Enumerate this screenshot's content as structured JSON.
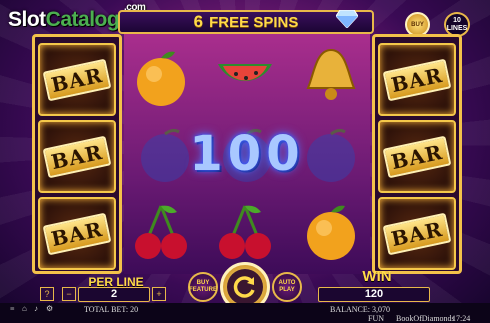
{
  "logo": {
    "text_slot": "Slot",
    "text_catalog": "Catalog",
    "text_com": ".com"
  },
  "header": {
    "spins_count": "6",
    "spins_label": "FREE SPINS"
  },
  "badges": {
    "buy_text": "BUY",
    "lines_count": "10",
    "lines_label": "LINES"
  },
  "reels": {
    "left_column": [
      "BAR",
      "BAR",
      "BAR"
    ],
    "right_column": [
      "BAR",
      "BAR",
      "BAR"
    ],
    "middle": [
      [
        "orange",
        "watermelon",
        "bell"
      ],
      [
        "plum",
        "plum",
        "plum"
      ],
      [
        "cherries",
        "cherries",
        "orange"
      ]
    ]
  },
  "win_display": "100",
  "controls": {
    "help": "?",
    "per_line_label": "PER LINE",
    "per_line_value": "2",
    "minus": "−",
    "plus": "+",
    "buy_feature": "BUY FEATURE",
    "auto_play": "AUTO PLAY",
    "win_label": "WIN",
    "win_value": "120"
  },
  "status": {
    "total_bet": "TOTAL BET: 20",
    "balance": "BALANCE: 3,070",
    "mode": "FUN",
    "game": "BookOfDiamonds",
    "time": "17:24"
  },
  "colors": {
    "gold": "#e8b84a",
    "win_blue": "#a9c8ff",
    "logo_green": "#4caf50"
  }
}
